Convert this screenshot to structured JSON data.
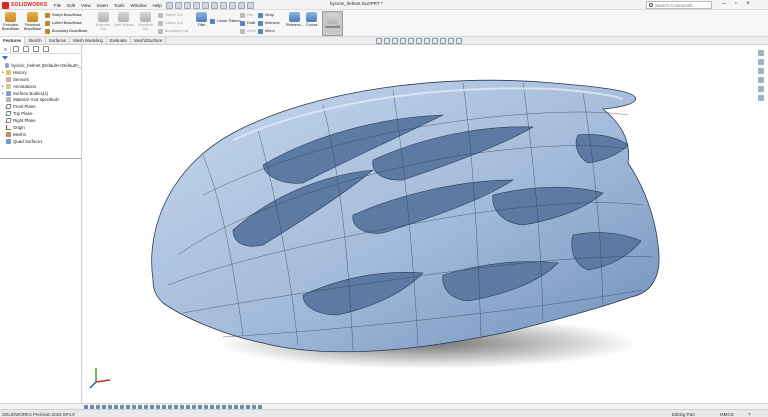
{
  "app": {
    "brand": "SOLIDWORKS",
    "document_title": "bycicle_helmet.SLDPRT *"
  },
  "menu": [
    "File",
    "Edit",
    "View",
    "Insert",
    "Tools",
    "Window",
    "Help"
  ],
  "search": {
    "placeholder": "Search Commands"
  },
  "ribbon": {
    "extruded": "Extruded\nBoss/Base",
    "revolved": "Revolved\nBoss/Base",
    "swept": "Swept Boss/Base",
    "lofted": "Lofted Boss/Base",
    "boundary": "Boundary Boss/Base",
    "extruded_cut": "Extruded\nCut",
    "hole_wizard": "Hole Wizard",
    "revolved_cut": "Revolved\nCut",
    "swept_cut": "Swept Cut",
    "lofted_cut": "Lofted Cut",
    "boundary_cut": "Boundary Cut",
    "fillet": "Fillet",
    "linear_pattern": "Linear Pattern",
    "rib": "Rib",
    "draft": "Draft",
    "shell": "Shell",
    "wrap": "Wrap",
    "intersect": "Intersect",
    "mirror": "Mirror",
    "reference": "Referenc...",
    "curves": "Curves",
    "instant3d": "Instant3D"
  },
  "tabs": [
    {
      "label": "Features",
      "active": true
    },
    {
      "label": "Sketch",
      "active": false
    },
    {
      "label": "Surfaces",
      "active": false
    },
    {
      "label": "Mesh Modeling",
      "active": false
    },
    {
      "label": "Evaluate",
      "active": false
    },
    {
      "label": "Mesh2Surface",
      "active": false
    }
  ],
  "tree": [
    {
      "label": "bycicle_helmet  (Default<<Default>_",
      "icon": "part",
      "level": 0,
      "expand": ""
    },
    {
      "label": "History",
      "icon": "folder",
      "level": 1,
      "expand": "▸"
    },
    {
      "label": "Sensors",
      "icon": "sensor",
      "level": 1,
      "expand": ""
    },
    {
      "label": "Annotations",
      "icon": "note",
      "level": 1,
      "expand": "▸"
    },
    {
      "label": "Surface Bodies(1)",
      "icon": "surf",
      "level": 1,
      "expand": "▸"
    },
    {
      "label": "Material <not specified>",
      "icon": "mat",
      "level": 1,
      "expand": ""
    },
    {
      "label": "Front Plane",
      "icon": "plane",
      "level": 1,
      "expand": ""
    },
    {
      "label": "Top Plane",
      "icon": "plane",
      "level": 1,
      "expand": ""
    },
    {
      "label": "Right Plane",
      "icon": "plane",
      "level": 1,
      "expand": ""
    },
    {
      "label": "Origin",
      "icon": "origin",
      "level": 1,
      "expand": ""
    },
    {
      "label": "Mesh1",
      "icon": "mesh",
      "level": 1,
      "expand": ""
    },
    {
      "label": "Quad Surface1",
      "icon": "quad",
      "level": 1,
      "expand": ""
    }
  ],
  "status": {
    "left": "SOLIDWORKS Premium 2019 SP4.0",
    "mode": "Editing Part",
    "units": "MMGS"
  },
  "colors": {
    "helmet_surface": "#a9c0de",
    "helmet_dark": "#6f8fb8",
    "brand_red": "#d8261d"
  }
}
